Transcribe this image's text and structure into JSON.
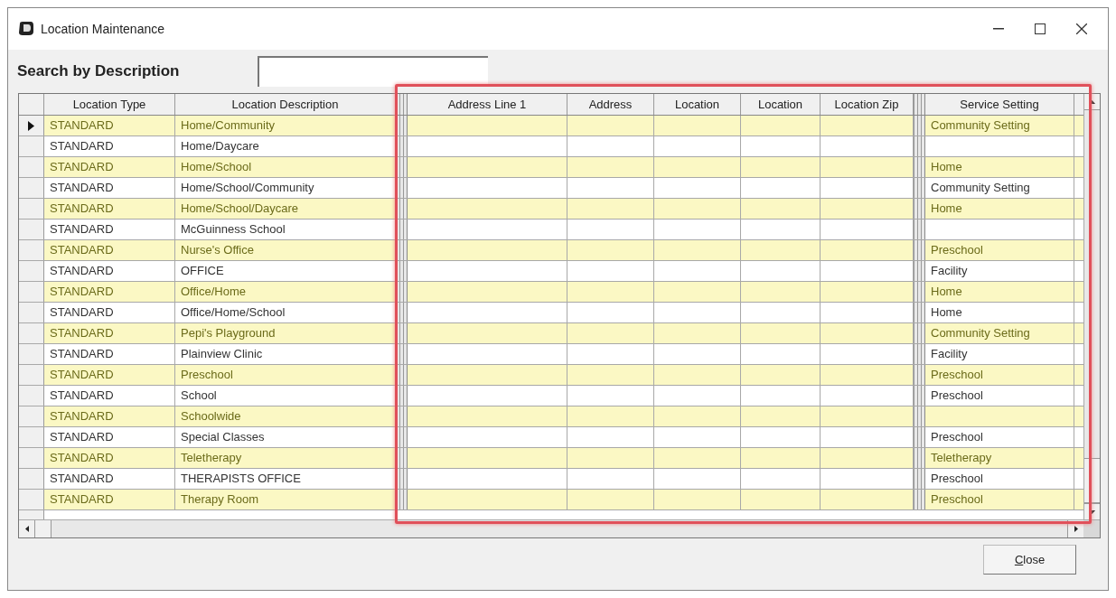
{
  "window": {
    "title": "Location Maintenance"
  },
  "search": {
    "label": "Search by Description"
  },
  "table": {
    "columns": [
      "Location Type",
      "Location Description",
      "Address Line 1",
      "Address",
      "Location",
      "Location",
      "Location Zip",
      "Service Setting"
    ],
    "rows": [
      {
        "selected": true,
        "cells": [
          "STANDARD",
          "Home/Community",
          "",
          "",
          "",
          "",
          "",
          "Community Setting"
        ]
      },
      {
        "selected": false,
        "cells": [
          "STANDARD",
          "Home/Daycare",
          "",
          "",
          "",
          "",
          "",
          ""
        ]
      },
      {
        "selected": false,
        "cells": [
          "STANDARD",
          "Home/School",
          "",
          "",
          "",
          "",
          "",
          "Home"
        ]
      },
      {
        "selected": false,
        "cells": [
          "STANDARD",
          "Home/School/Community",
          "",
          "",
          "",
          "",
          "",
          "Community Setting"
        ]
      },
      {
        "selected": false,
        "cells": [
          "STANDARD",
          "Home/School/Daycare",
          "",
          "",
          "",
          "",
          "",
          "Home"
        ]
      },
      {
        "selected": false,
        "cells": [
          "STANDARD",
          "McGuinness School",
          "",
          "",
          "",
          "",
          "",
          ""
        ]
      },
      {
        "selected": false,
        "cells": [
          "STANDARD",
          "Nurse's Office",
          "",
          "",
          "",
          "",
          "",
          "Preschool"
        ]
      },
      {
        "selected": false,
        "cells": [
          "STANDARD",
          "OFFICE",
          "",
          "",
          "",
          "",
          "",
          "Facility"
        ]
      },
      {
        "selected": false,
        "cells": [
          "STANDARD",
          "Office/Home",
          "",
          "",
          "",
          "",
          "",
          "Home"
        ]
      },
      {
        "selected": false,
        "cells": [
          "STANDARD",
          "Office/Home/School",
          "",
          "",
          "",
          "",
          "",
          "Home"
        ]
      },
      {
        "selected": false,
        "cells": [
          "STANDARD",
          "Pepi's Playground",
          "",
          "",
          "",
          "",
          "",
          "Community Setting"
        ]
      },
      {
        "selected": false,
        "cells": [
          "STANDARD",
          "Plainview Clinic",
          "",
          "",
          "",
          "",
          "",
          "Facility"
        ]
      },
      {
        "selected": false,
        "cells": [
          "STANDARD",
          "Preschool",
          "",
          "",
          "",
          "",
          "",
          "Preschool"
        ]
      },
      {
        "selected": false,
        "cells": [
          "STANDARD",
          "School",
          "",
          "",
          "",
          "",
          "",
          "Preschool"
        ]
      },
      {
        "selected": false,
        "cells": [
          "STANDARD",
          "Schoolwide",
          "",
          "",
          "",
          "",
          "",
          ""
        ]
      },
      {
        "selected": false,
        "cells": [
          "STANDARD",
          "Special Classes",
          "",
          "",
          "",
          "",
          "",
          "Preschool"
        ]
      },
      {
        "selected": false,
        "cells": [
          "STANDARD",
          "Teletherapy",
          "",
          "",
          "",
          "",
          "",
          "Teletherapy"
        ]
      },
      {
        "selected": false,
        "cells": [
          "STANDARD",
          "THERAPISTS OFFICE",
          "",
          "",
          "",
          "",
          "",
          "Preschool"
        ]
      },
      {
        "selected": false,
        "cells": [
          "STANDARD",
          "Therapy Room",
          "",
          "",
          "",
          "",
          "",
          "Preschool"
        ]
      }
    ]
  },
  "highlight": {
    "on": true
  },
  "buttons": [
    "Close"
  ]
}
